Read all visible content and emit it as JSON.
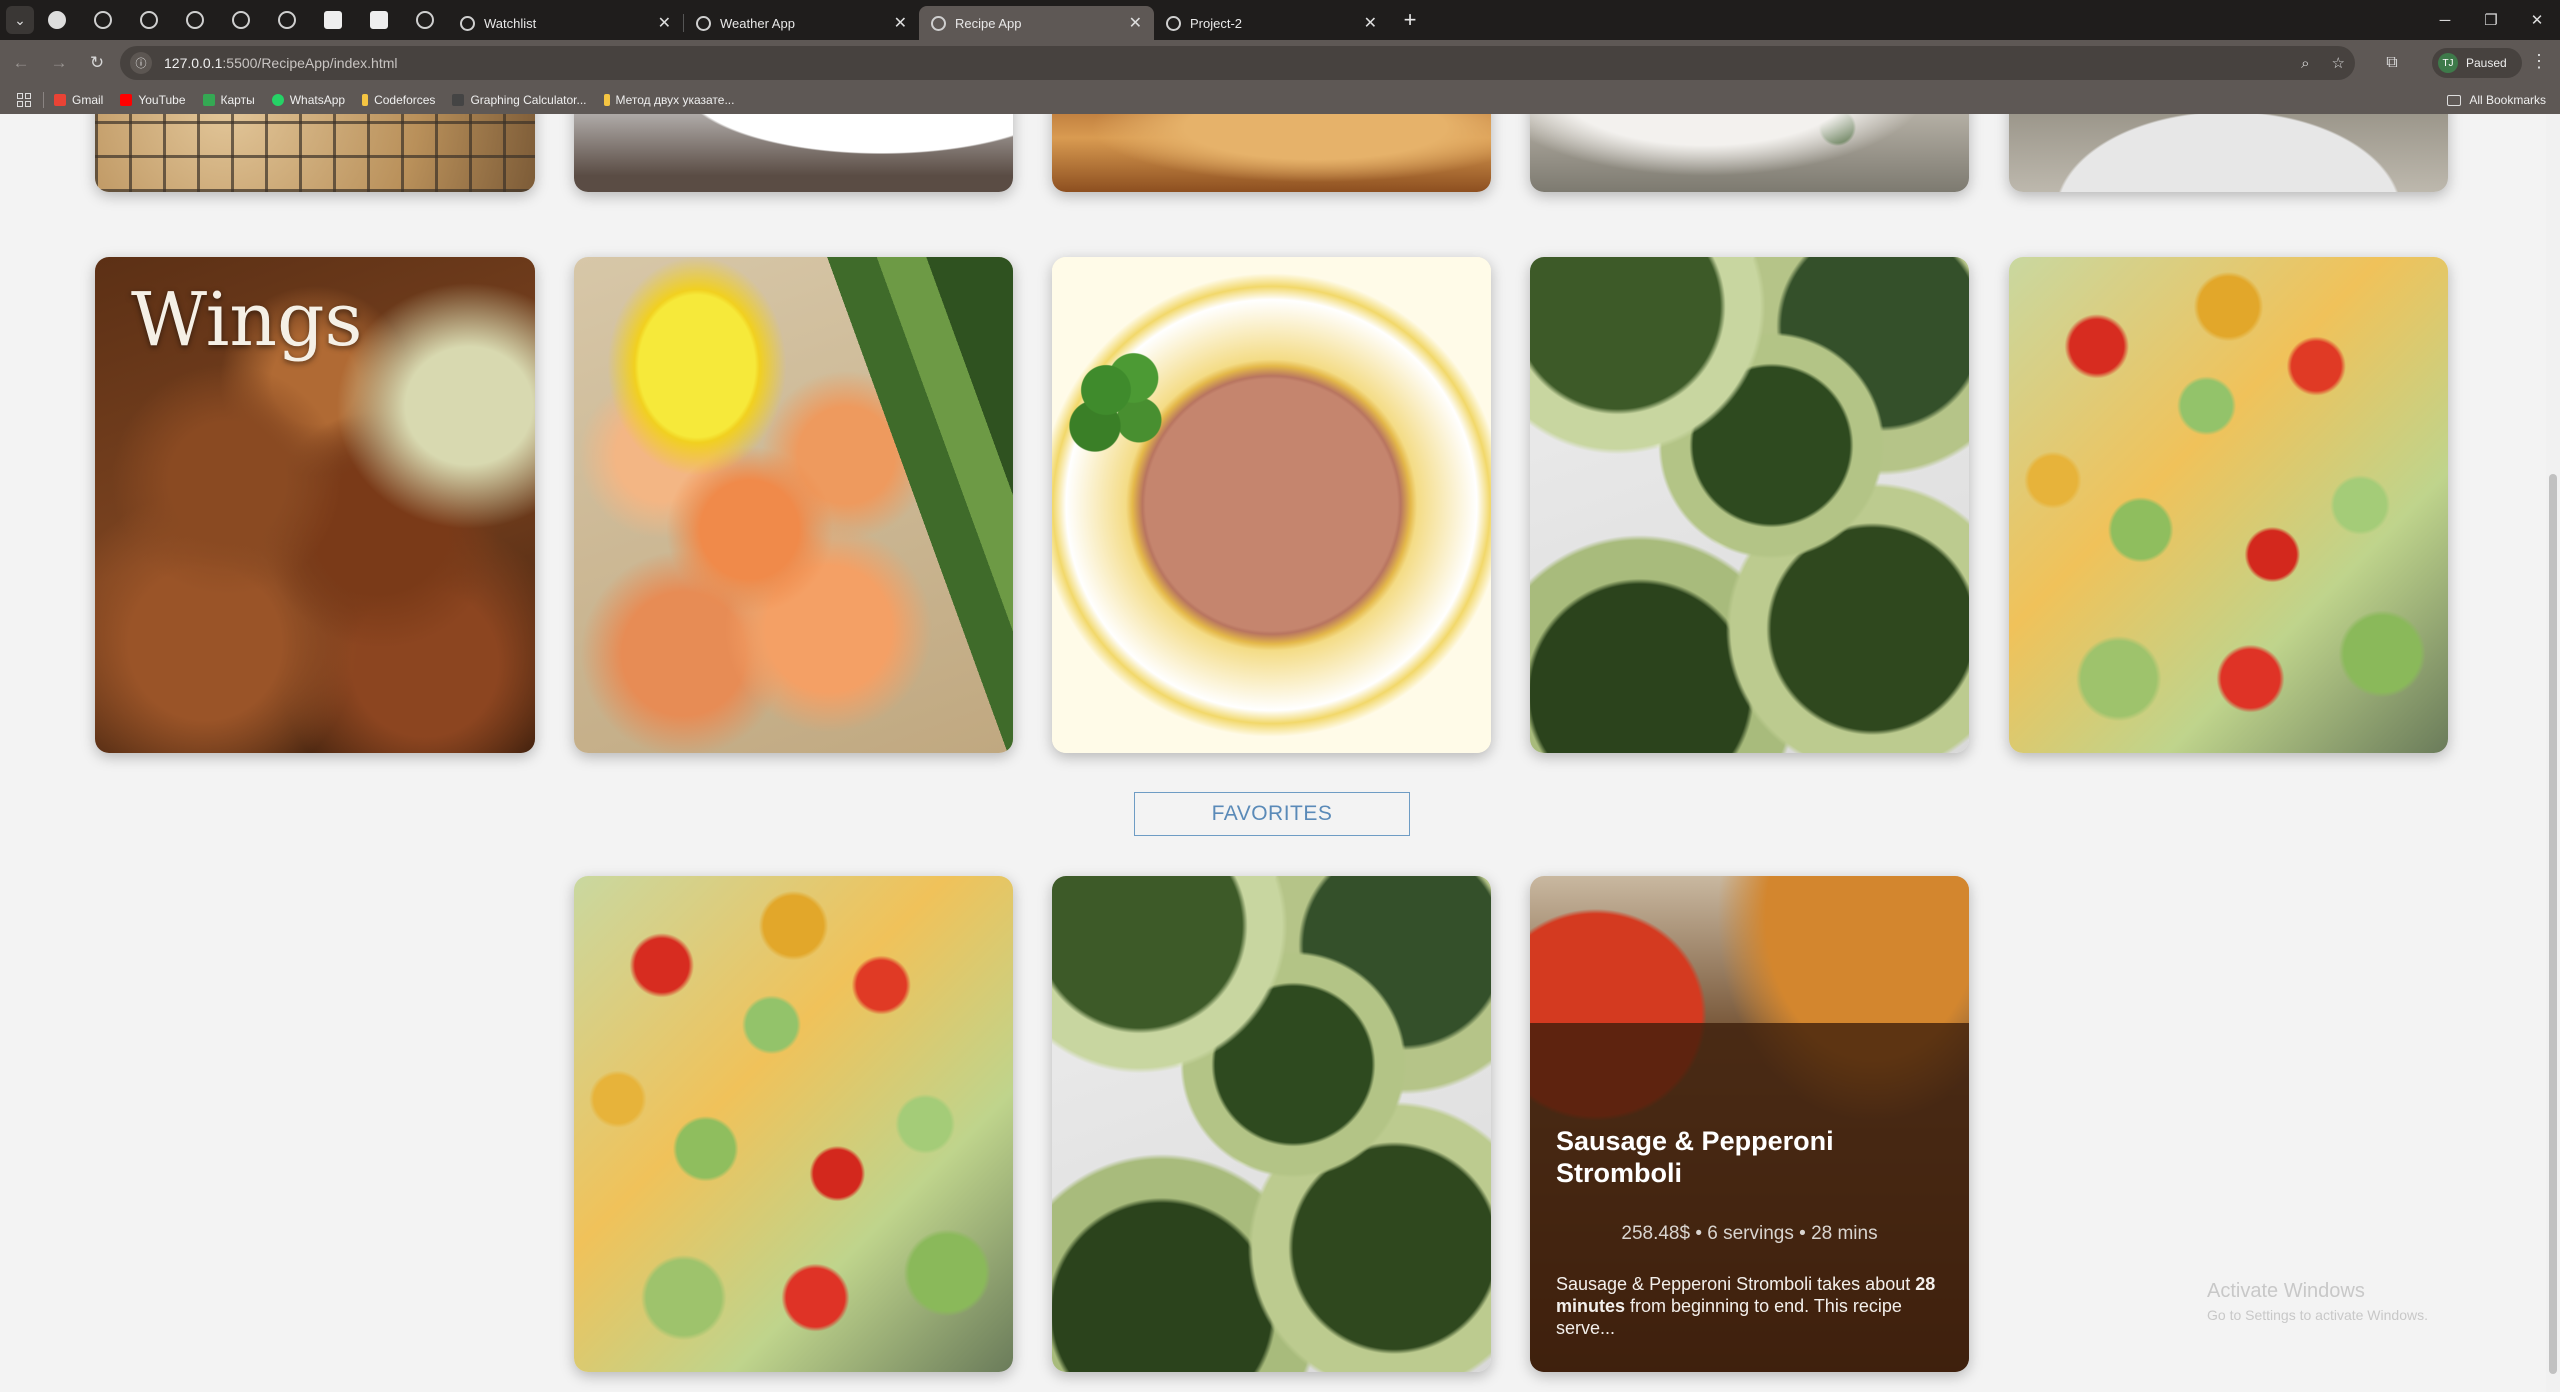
{
  "browser": {
    "tabs": [
      {
        "title": "Watchlist",
        "active": false
      },
      {
        "title": "Weather App",
        "active": false
      },
      {
        "title": "Recipe App",
        "active": true
      },
      {
        "title": "Project-2",
        "active": false
      }
    ],
    "url_host": "127.0.0.1",
    "url_rest": ":5500/RecipeApp/index.html",
    "profile_initial": "TJ",
    "profile_status": "Paused",
    "bookmarks": [
      {
        "label": "Gmail",
        "color": "#ea4335"
      },
      {
        "label": "YouTube",
        "color": "#ff0000"
      },
      {
        "label": "Карты",
        "color": "#34a853"
      },
      {
        "label": "WhatsApp",
        "color": "#25d366"
      },
      {
        "label": "Codeforces",
        "color": "#f5c542"
      },
      {
        "label": "Graphing Calculator...",
        "color": "#444444"
      },
      {
        "label": "Метод двух указате...",
        "color": "#f5c542"
      }
    ],
    "all_bookmarks": "All Bookmarks"
  },
  "recipes": {
    "row_top_partial": [
      "cookies",
      "candy plate",
      "bread",
      "cheese dish",
      "white plate"
    ],
    "row_main": [
      {
        "image": "chicken wings",
        "overlay_text": "Wings"
      },
      {
        "image": "garlic shrimp with asparagus"
      },
      {
        "image": "refried beans"
      },
      {
        "image": "grilled zucchini with feta"
      },
      {
        "image": "avocado salsa dip"
      }
    ]
  },
  "favorites": {
    "heading": "FAVORITES",
    "items": [
      {
        "image": "avocado salsa dip"
      },
      {
        "image": "grilled zucchini with feta"
      },
      {
        "image": "stromboli",
        "title": "Sausage & Pepperoni Stromboli",
        "price": "258.48$",
        "servings": "6 servings",
        "time": "28 mins",
        "meta": "258.48$ • 6 servings • 28 mins",
        "desc_prefix": "Sausage & Pepperoni Stromboli takes about ",
        "desc_bold": "28 minutes",
        "desc_suffix": " from beginning to end. This recipe serve..."
      }
    ]
  },
  "watermark": {
    "line1": "Activate Windows",
    "line2": "Go to Settings to activate Windows."
  }
}
